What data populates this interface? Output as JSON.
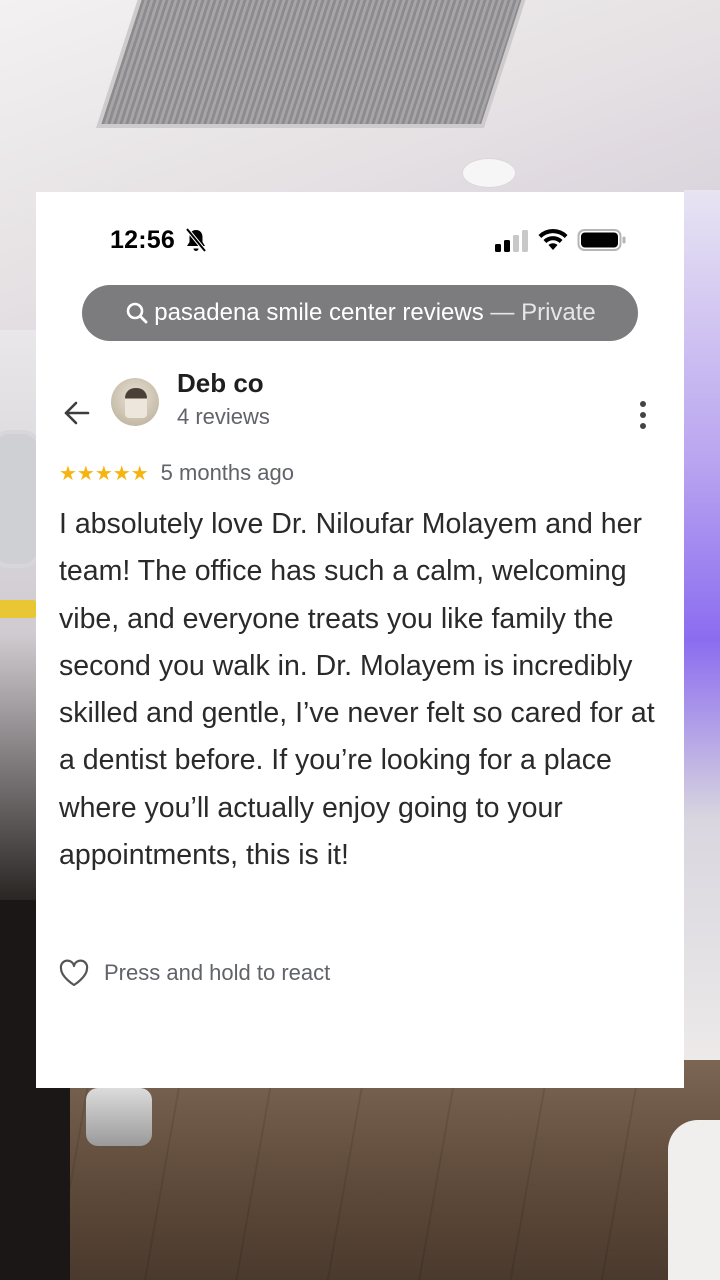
{
  "status_bar": {
    "time": "12:56"
  },
  "browser": {
    "url_text": "pasadena smile center reviews",
    "url_separator": " — ",
    "mode_label": "Private"
  },
  "review": {
    "reviewer_name": "Deb co",
    "review_count": "4 reviews",
    "stars": "★★★★★",
    "rating": 5,
    "date": "5 months ago",
    "text": "I absolutely love Dr. Niloufar Molayem and her team! The office has such a calm, welcoming vibe, and everyone treats you like family the second you walk in. Dr. Molayem is incredibly skilled and gentle, I’ve never felt so cared for at a dentist before. If you’re looking for a place where you’ll actually enjoy going to your appointments, this is it!",
    "react_label": "Press and hold to react"
  },
  "colors": {
    "star": "#f6b40e",
    "url_bar": "#7c7c7e",
    "secondary_text": "#606368"
  },
  "icons": [
    "bell-off-icon",
    "signal-icon",
    "wifi-icon",
    "battery-icon",
    "search-icon",
    "back-arrow-icon",
    "more-vert-icon",
    "heart-icon"
  ]
}
